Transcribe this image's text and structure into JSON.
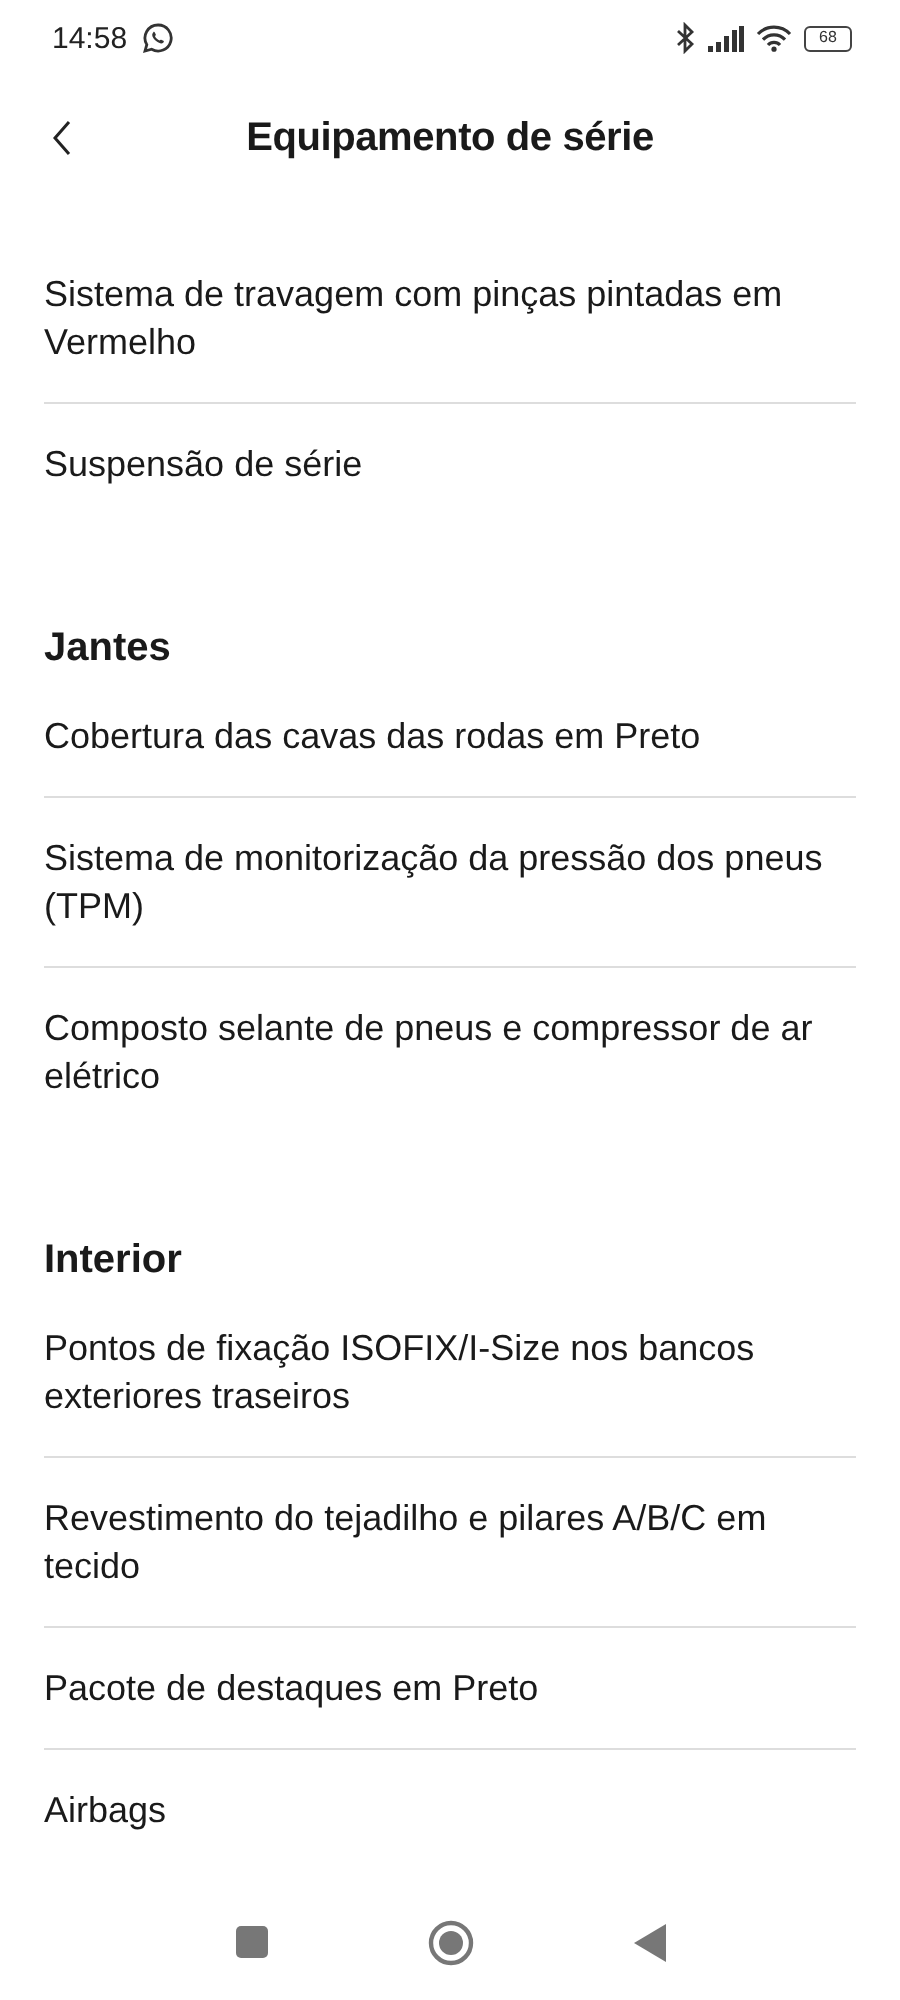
{
  "status_bar": {
    "time": "14:58",
    "battery": "68"
  },
  "header": {
    "title": "Equipamento de série"
  },
  "sections": [
    {
      "items": [
        "Sistema de travagem com pinças pintadas em Vermelho",
        "Suspensão de série"
      ]
    },
    {
      "heading": "Jantes",
      "items": [
        "Cobertura das cavas das rodas em Preto",
        "Sistema de monitorização da pressão dos pneus (TPM)",
        "Composto selante de pneus e compressor de ar elétrico"
      ]
    },
    {
      "heading": "Interior",
      "items": [
        "Pontos de fixação ISOFIX/I-Size nos bancos exteriores traseiros",
        "Revestimento do tejadilho e pilares A/B/C em tecido",
        "Pacote de destaques em Preto",
        "Airbags"
      ]
    }
  ]
}
